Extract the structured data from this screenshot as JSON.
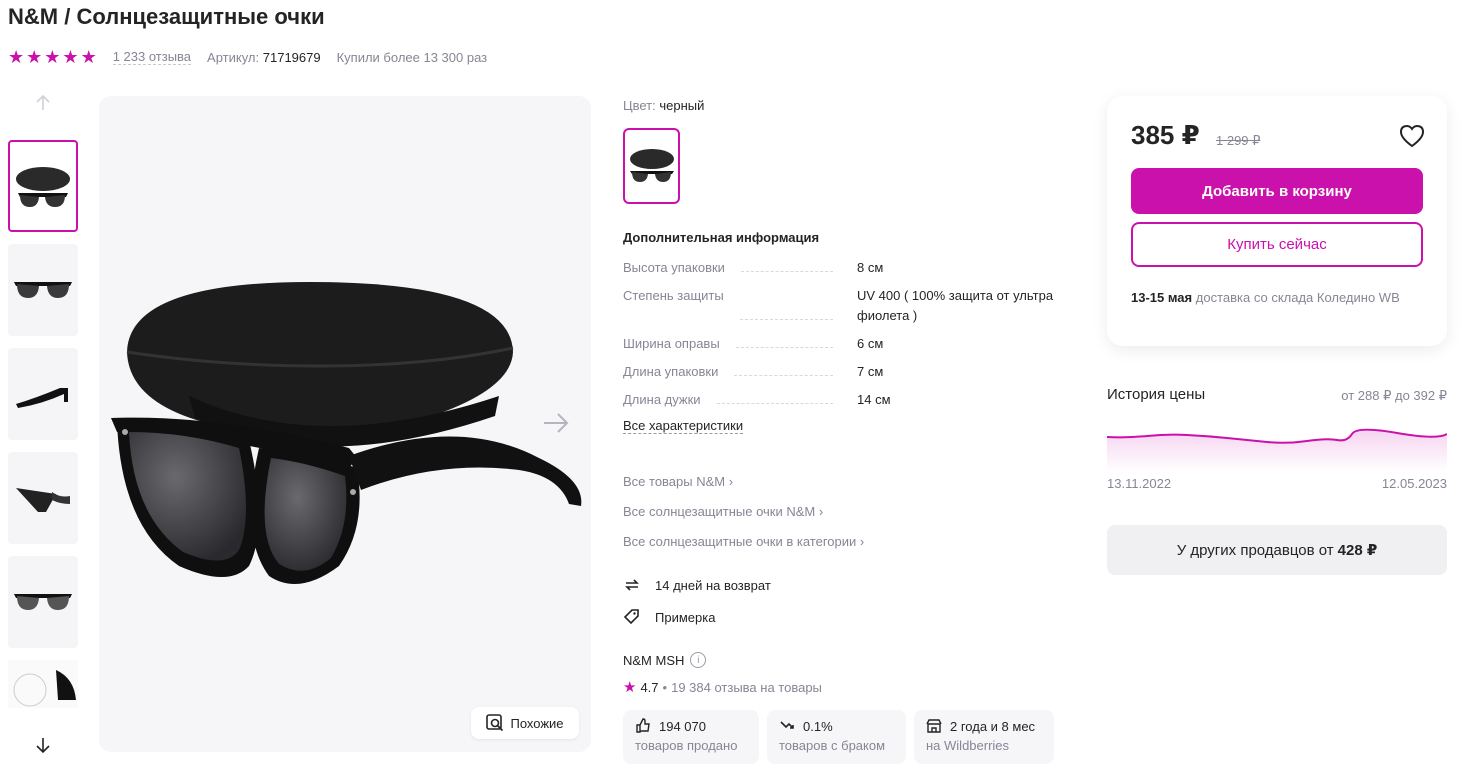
{
  "product": {
    "title": "N&M / Солнцезащитные очки",
    "rating_stars": 5,
    "reviews": "1 233 отзыва",
    "article_label": "Артикул:",
    "article_value": "71719679",
    "bought": "Купили более 13 300 раз"
  },
  "gallery": {
    "thumbnails_count": 6,
    "active_index": 0,
    "similar_label": "Похожие"
  },
  "details": {
    "color_label": "Цвет:",
    "color_value": "черный",
    "additional_info_title": "Дополнительная информация",
    "specs": [
      {
        "key": "Высота упаковки",
        "value": "8 см"
      },
      {
        "key": "Степень защиты",
        "value": "UV 400 ( 100% защита от ультра фиолета )"
      },
      {
        "key": "Ширина оправы",
        "value": "6 см"
      },
      {
        "key": "Длина упаковки",
        "value": "7 см"
      },
      {
        "key": "Длина дужки",
        "value": "14 см"
      }
    ],
    "all_specs_link": "Все характеристики",
    "links": [
      "Все товары N&M",
      "Все солнцезащитные очки N&M",
      "Все солнцезащитные очки в категории"
    ],
    "features": [
      {
        "icon": "return-icon",
        "label": "14 дней на возврат"
      },
      {
        "icon": "tag-icon",
        "label": "Примерка"
      }
    ]
  },
  "seller": {
    "name": "N&M MSH",
    "rating": "4.7",
    "reviews": "19 384 отзыва на товары",
    "stats": [
      {
        "icon": "thumb-up-icon",
        "value": "194 070",
        "label": "товаров продано"
      },
      {
        "icon": "trend-down-icon",
        "value": "0.1%",
        "label": "товаров с браком"
      },
      {
        "icon": "store-icon",
        "value": "2 года и 8 мес",
        "label": "на Wildberries"
      }
    ]
  },
  "price": {
    "current": "385 ₽",
    "old": "1 299 ₽",
    "add_to_cart": "Добавить в корзину",
    "buy_now": "Купить сейчас",
    "delivery_date": "13-15 мая",
    "delivery_text": "доставка со склада Коледино WB"
  },
  "price_history": {
    "title": "История цены",
    "range_from": "от 288 ₽",
    "range_to": "до 392 ₽",
    "date_start": "13.11.2022",
    "date_end": "12.05.2023",
    "accent_color": "#cb11ab"
  },
  "other_sellers": {
    "label": "У других продавцов от",
    "price": "428 ₽"
  },
  "colors": {
    "brand": "#cb11ab",
    "text": "#242424",
    "muted": "#868695"
  }
}
